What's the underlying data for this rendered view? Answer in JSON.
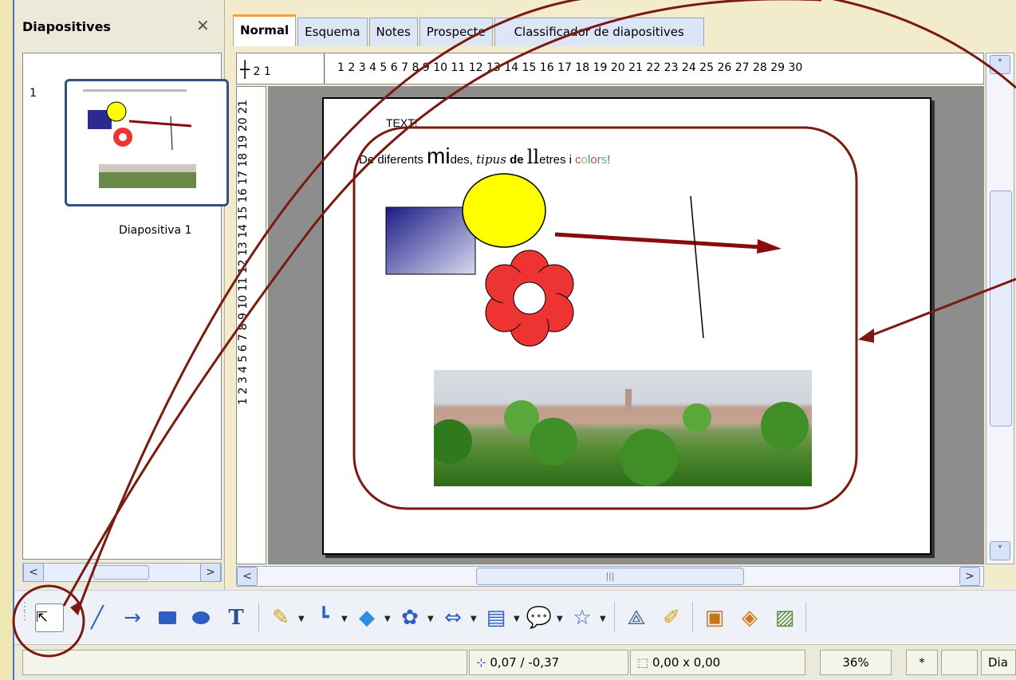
{
  "slides_pane": {
    "title": "Diapositives",
    "close": "✕",
    "slide_number": "1",
    "slide_name": "Diapositiva 1"
  },
  "tabs": [
    "Normal",
    "Esquema",
    "Notes",
    "Prospecte",
    "Classificador de diapositives"
  ],
  "rulers": {
    "h_corner": "2 1",
    "h_numbers": "1  2  3  4  5  6  7  8  9  10 11 12 13 14 15 16 17 18 19 20 21 22 23 24 25 26 27 28 29 30",
    "v_numbers": "1  2  3  4  5  6  7  8  9  10 11 12 13 14 15 16 17 18 19 20 21"
  },
  "slide": {
    "title": "TEXT!",
    "line_prefix": "De diferents ",
    "big": "mi",
    "after_big": "des, ",
    "script": "tipus",
    "bold": "de",
    "tall": "ll",
    "tall_rest": "etres i ",
    "colors_word": "colors",
    "bang": "!"
  },
  "status": {
    "position": "0,07 / -0,37",
    "size": "0,00 x 0,00",
    "zoom": "36%",
    "modified": "*",
    "layout": "Dia"
  },
  "colors": {
    "accent_orange": "#f0a040",
    "annotation": "#7a1a10",
    "flower_red": "#ee3333",
    "circle_yellow": "#ffff00",
    "rect_blue": "#23238c",
    "arrow_red": "#8b0a0a"
  },
  "icons": [
    "select-icon",
    "line-icon",
    "arrow-icon",
    "rectangle-icon",
    "ellipse-icon",
    "text-icon",
    "pencil-icon",
    "connector-icon",
    "diamond-icon",
    "flower-icon",
    "block-arrow-icon",
    "flowchart-icon",
    "callout-icon",
    "star-icon",
    "points-icon",
    "glue-icon",
    "fontwork-icon",
    "image-icon"
  ]
}
